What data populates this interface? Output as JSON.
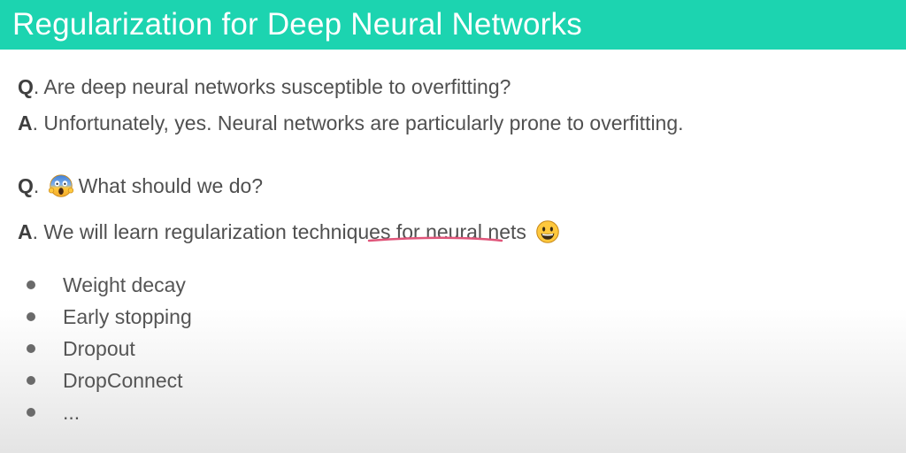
{
  "title": "Regularization for Deep Neural Networks",
  "qa": [
    {
      "q_prefix": "Q",
      "q_text": ". Are deep neural networks susceptible to overfitting?",
      "a_prefix": "A",
      "a_text": ". Unfortunately, yes. Neural networks are particularly prone to overfitting."
    },
    {
      "q_prefix": "Q",
      "q_dot": ".",
      "q_text": "What should we do?",
      "q_emoji": "face-screaming-in-fear-icon",
      "a_prefix": "A",
      "a_text": ". We will learn regularization techniques for neural nets",
      "a_emoji": "grinning-face-icon"
    }
  ],
  "techniques": [
    "Weight decay",
    "Early stopping",
    "Dropout",
    "DropConnect",
    "..."
  ],
  "colors": {
    "title_bar": "#1cd4b0",
    "annotation_stroke": "#e0557a",
    "emoji_yellow": "#ffc83d"
  }
}
